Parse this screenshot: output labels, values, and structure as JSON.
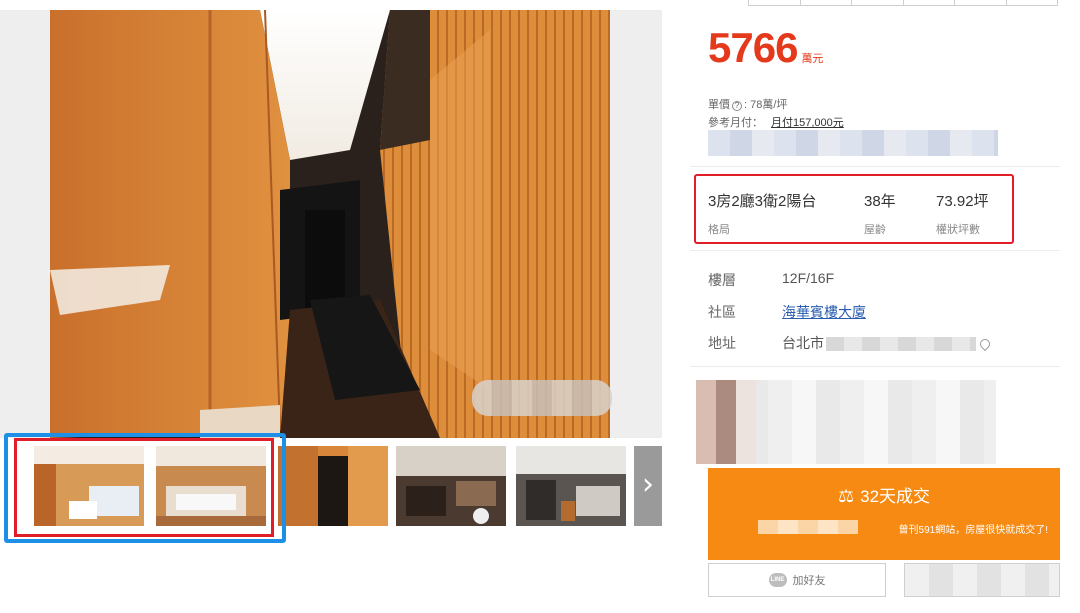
{
  "listing": {
    "price": "5766",
    "price_unit": "萬元",
    "unit_price_label": "單價",
    "unit_price_value": ": 78萬/坪",
    "monthly_label": "參考月付：",
    "monthly_value": "月付157,000元"
  },
  "specs": [
    {
      "value": "3房2廳3衛2陽台",
      "label": "格局"
    },
    {
      "value": "38年",
      "label": "屋齡"
    },
    {
      "value": "73.92坪",
      "label": "權狀坪數"
    }
  ],
  "details": {
    "floor_label": "樓層",
    "floor_value": "12F/16F",
    "community_label": "社區",
    "community_value": "海華賓樓大廈",
    "address_label": "地址",
    "address_value": "台北市"
  },
  "deal": {
    "title": "32天成交",
    "subtitle": "曾刊591網站，房屋很快就成交了!"
  },
  "buttons": {
    "line_label": "加好友"
  },
  "gallery": {
    "next_arrow": "›"
  },
  "colors": {
    "price": "#e4391b",
    "deal_banner": "#f78a13",
    "highlight_red": "#e21d2a",
    "highlight_blue": "#1e8fe6"
  }
}
